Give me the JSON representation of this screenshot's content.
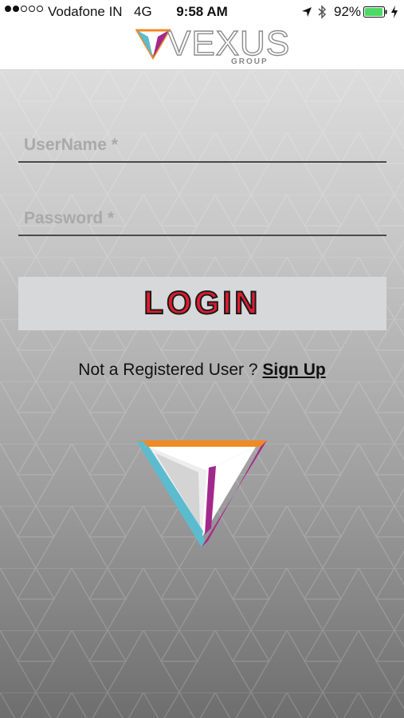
{
  "status_bar": {
    "carrier": "Vodafone IN",
    "network": "4G",
    "time": "9:58 AM",
    "battery": "92%",
    "signal_bars_filled": 2,
    "signal_bars_total": 5,
    "icons": [
      "location-arrow-icon",
      "bluetooth-icon",
      "battery-icon",
      "charging-bolt-icon"
    ]
  },
  "header": {
    "brand": "VEXUS",
    "brand_sub": "GROUP"
  },
  "form": {
    "username_placeholder": "UserName *",
    "password_placeholder": "Password *",
    "login_label": "LOGIN"
  },
  "register": {
    "prompt": "Not a Registered User ? ",
    "link": "Sign Up"
  },
  "colors": {
    "login_text": "#e01b2f",
    "logo_orange": "#f08a24",
    "logo_cyan": "#5bbccf",
    "logo_magenta": "#a3288c",
    "battery_green": "#4cd964"
  }
}
